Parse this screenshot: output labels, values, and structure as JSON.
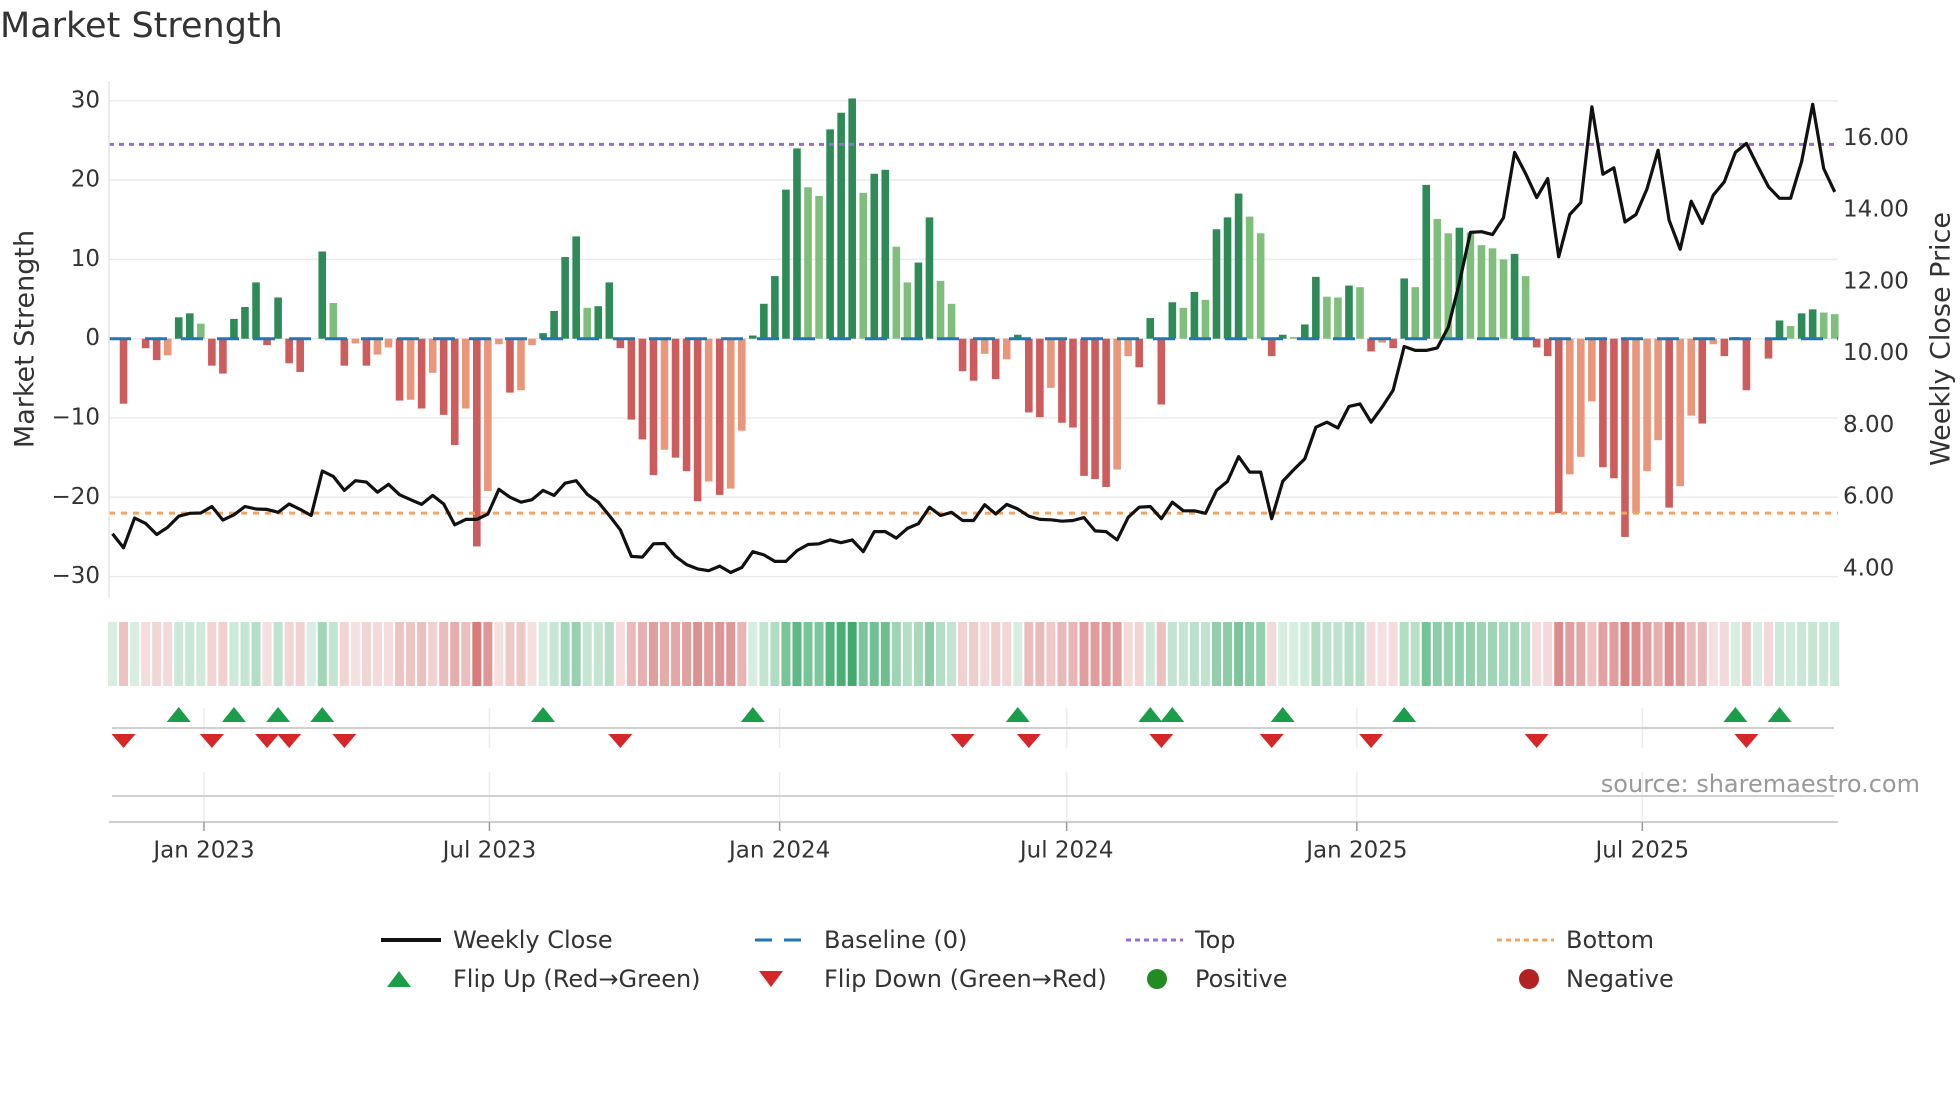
{
  "title": "Market Strength",
  "source": "source: sharemaestro.com",
  "colors": {
    "pos_dark": "#2e8b57",
    "pos_light": "#7fbf7b",
    "neg_dark": "#cd5c5c",
    "neg_light": "#e9967a",
    "baseline": "#1f77b4",
    "top": "#9b6bd6",
    "bottom": "#f4a460",
    "flip_up": "#1a9e4a",
    "flip_down": "#d62728",
    "positive": "#228b22",
    "negative": "#b22222",
    "heat_pos": "#2ca25f",
    "heat_neg": "#cd5c5c"
  },
  "legend": {
    "weekly_close": "Weekly Close",
    "baseline": "Baseline (0)",
    "top": "Top",
    "bottom": "Bottom",
    "flip_up": "Flip Up (Red→Green)",
    "flip_down": "Flip Down (Green→Red)",
    "positive": "Positive",
    "negative": "Negative"
  },
  "chart_data": {
    "type": "bar",
    "title": "Market Strength",
    "ylabel": "Market Strength",
    "y2label": "Weekly Close Price",
    "ylim": [
      -32.7,
      32.5
    ],
    "y2lim": [
      3.19,
      17.6
    ],
    "yticks": [
      "30",
      "20",
      "10",
      "0",
      "−10",
      "−20",
      "−30"
    ],
    "ytick_values": [
      30,
      20,
      10,
      0,
      -10,
      -20,
      -30
    ],
    "y2ticks": [
      "16.00",
      "14.00",
      "12.00",
      "10.00",
      "8.00",
      "6.00",
      "4.00"
    ],
    "y2tick_values": [
      16,
      14,
      12,
      10,
      8,
      6,
      4
    ],
    "xticks": [
      "Jan 2023",
      "Jul 2023",
      "Jan 2024",
      "Jul 2024",
      "Jan 2025",
      "Jul 2025"
    ],
    "xtick_dates": [
      "2023-01-01",
      "2023-07-01",
      "2024-01-01",
      "2024-07-01",
      "2025-01-01",
      "2025-07-01"
    ],
    "start_date": "2022-11-04",
    "interval_days": 7,
    "top_level": 24.5,
    "bottom_level": -22,
    "baseline": 0,
    "strength": [
      0,
      -8.2,
      0,
      -1.2,
      -2.7,
      -2.1,
      2.7,
      3.2,
      1.9,
      -3.4,
      -4.4,
      2.5,
      4,
      7.1,
      -0.8,
      5.2,
      -3.1,
      -4.2,
      0,
      11,
      4.5,
      -3.4,
      -0.6,
      -3.4,
      -2,
      -1.1,
      -7.8,
      -7.7,
      -8.8,
      -4.3,
      -9.6,
      -13.4,
      -8.8,
      -26.2,
      -19.2,
      -0.7,
      -6.8,
      -6.5,
      -0.8,
      0.7,
      3.5,
      10.3,
      12.9,
      3.9,
      4.1,
      7.1,
      -1.2,
      -10.2,
      -12.7,
      -17.2,
      -14,
      -15,
      -16.7,
      -20.5,
      -18,
      -19.7,
      -18.9,
      -11.6,
      0.4,
      4.4,
      7.9,
      18.8,
      24,
      19.1,
      18,
      26.4,
      28.5,
      30.3,
      18.4,
      20.8,
      21.3,
      11.6,
      7.1,
      9.6,
      15.3,
      7.3,
      4.4,
      -4.1,
      -5.3,
      -1.9,
      -5.1,
      -2.6,
      0.5,
      -9.3,
      -9.9,
      -6.2,
      -10.6,
      -11.2,
      -17.3,
      -17.7,
      -18.7,
      -16.5,
      -2.2,
      -3.6,
      2.6,
      -8.3,
      4.6,
      3.9,
      5.9,
      4.9,
      13.8,
      15.3,
      18.3,
      15.4,
      13.3,
      -2.2,
      0.5,
      0.2,
      1.8,
      7.8,
      5.3,
      5.2,
      6.7,
      6.5,
      -1.6,
      -0.5,
      -1.2,
      7.6,
      6.5,
      19.4,
      15.1,
      13.3,
      14,
      13.4,
      11.8,
      11.4,
      10,
      10.7,
      7.9,
      -1.1,
      -2.2,
      -22,
      -17.1,
      -14.9,
      -7.9,
      -16.2,
      -17.6,
      -25,
      -22,
      -16.7,
      -12.8,
      -21.3,
      -18.6,
      -9.7,
      -10.7,
      -0.7,
      -2.2,
      0.2,
      -6.5,
      0,
      -2.5,
      2.3,
      1.6,
      3.2,
      3.7,
      3.3,
      3.1
    ],
    "weekly_close": [
      4.98,
      4.59,
      5.42,
      5.27,
      4.96,
      5.16,
      5.47,
      5.55,
      5.56,
      5.74,
      5.36,
      5.51,
      5.74,
      5.67,
      5.66,
      5.58,
      5.81,
      5.66,
      5.49,
      6.73,
      6.58,
      6.19,
      6.46,
      6.42,
      6.14,
      6.36,
      6.07,
      5.93,
      5.8,
      6.05,
      5.81,
      5.23,
      5.38,
      5.38,
      5.53,
      6.22,
      6.0,
      5.86,
      5.93,
      6.19,
      6.05,
      6.39,
      6.46,
      6.08,
      5.86,
      5.49,
      5.09,
      4.35,
      4.33,
      4.7,
      4.71,
      4.35,
      4.12,
      4.0,
      3.95,
      4.08,
      3.9,
      4.04,
      4.48,
      4.39,
      4.21,
      4.21,
      4.51,
      4.68,
      4.7,
      4.81,
      4.73,
      4.81,
      4.48,
      5.04,
      5.04,
      4.86,
      5.13,
      5.26,
      5.72,
      5.49,
      5.58,
      5.35,
      5.35,
      5.79,
      5.53,
      5.8,
      5.67,
      5.47,
      5.38,
      5.37,
      5.33,
      5.35,
      5.43,
      5.06,
      5.04,
      4.81,
      5.44,
      5.72,
      5.74,
      5.4,
      5.86,
      5.62,
      5.62,
      5.55,
      6.19,
      6.44,
      7.13,
      6.7,
      6.7,
      5.4,
      6.44,
      6.77,
      7.07,
      7.95,
      8.09,
      7.93,
      8.53,
      8.6,
      8.09,
      8.51,
      8.98,
      10.2,
      10.09,
      10.09,
      10.16,
      10.74,
      11.98,
      13.38,
      13.4,
      13.32,
      13.79,
      15.61,
      15.02,
      14.35,
      14.88,
      12.7,
      13.88,
      14.21,
      16.88,
      15.0,
      15.18,
      13.67,
      13.88,
      14.6,
      15.67,
      13.72,
      12.91,
      14.25,
      13.63,
      14.42,
      14.79,
      15.61,
      15.86,
      15.24,
      14.65,
      14.33,
      14.33,
      15.35,
      16.95,
      15.16,
      14.51
    ],
    "flip_up_weeks": [
      6,
      11,
      15,
      19,
      39,
      58,
      82,
      94,
      96,
      106,
      117,
      147,
      151
    ],
    "flip_down_weeks": [
      1,
      9,
      14,
      16,
      21,
      46,
      77,
      83,
      95,
      105,
      114,
      129,
      148
    ],
    "legend_position": "bottom",
    "grid": true
  }
}
